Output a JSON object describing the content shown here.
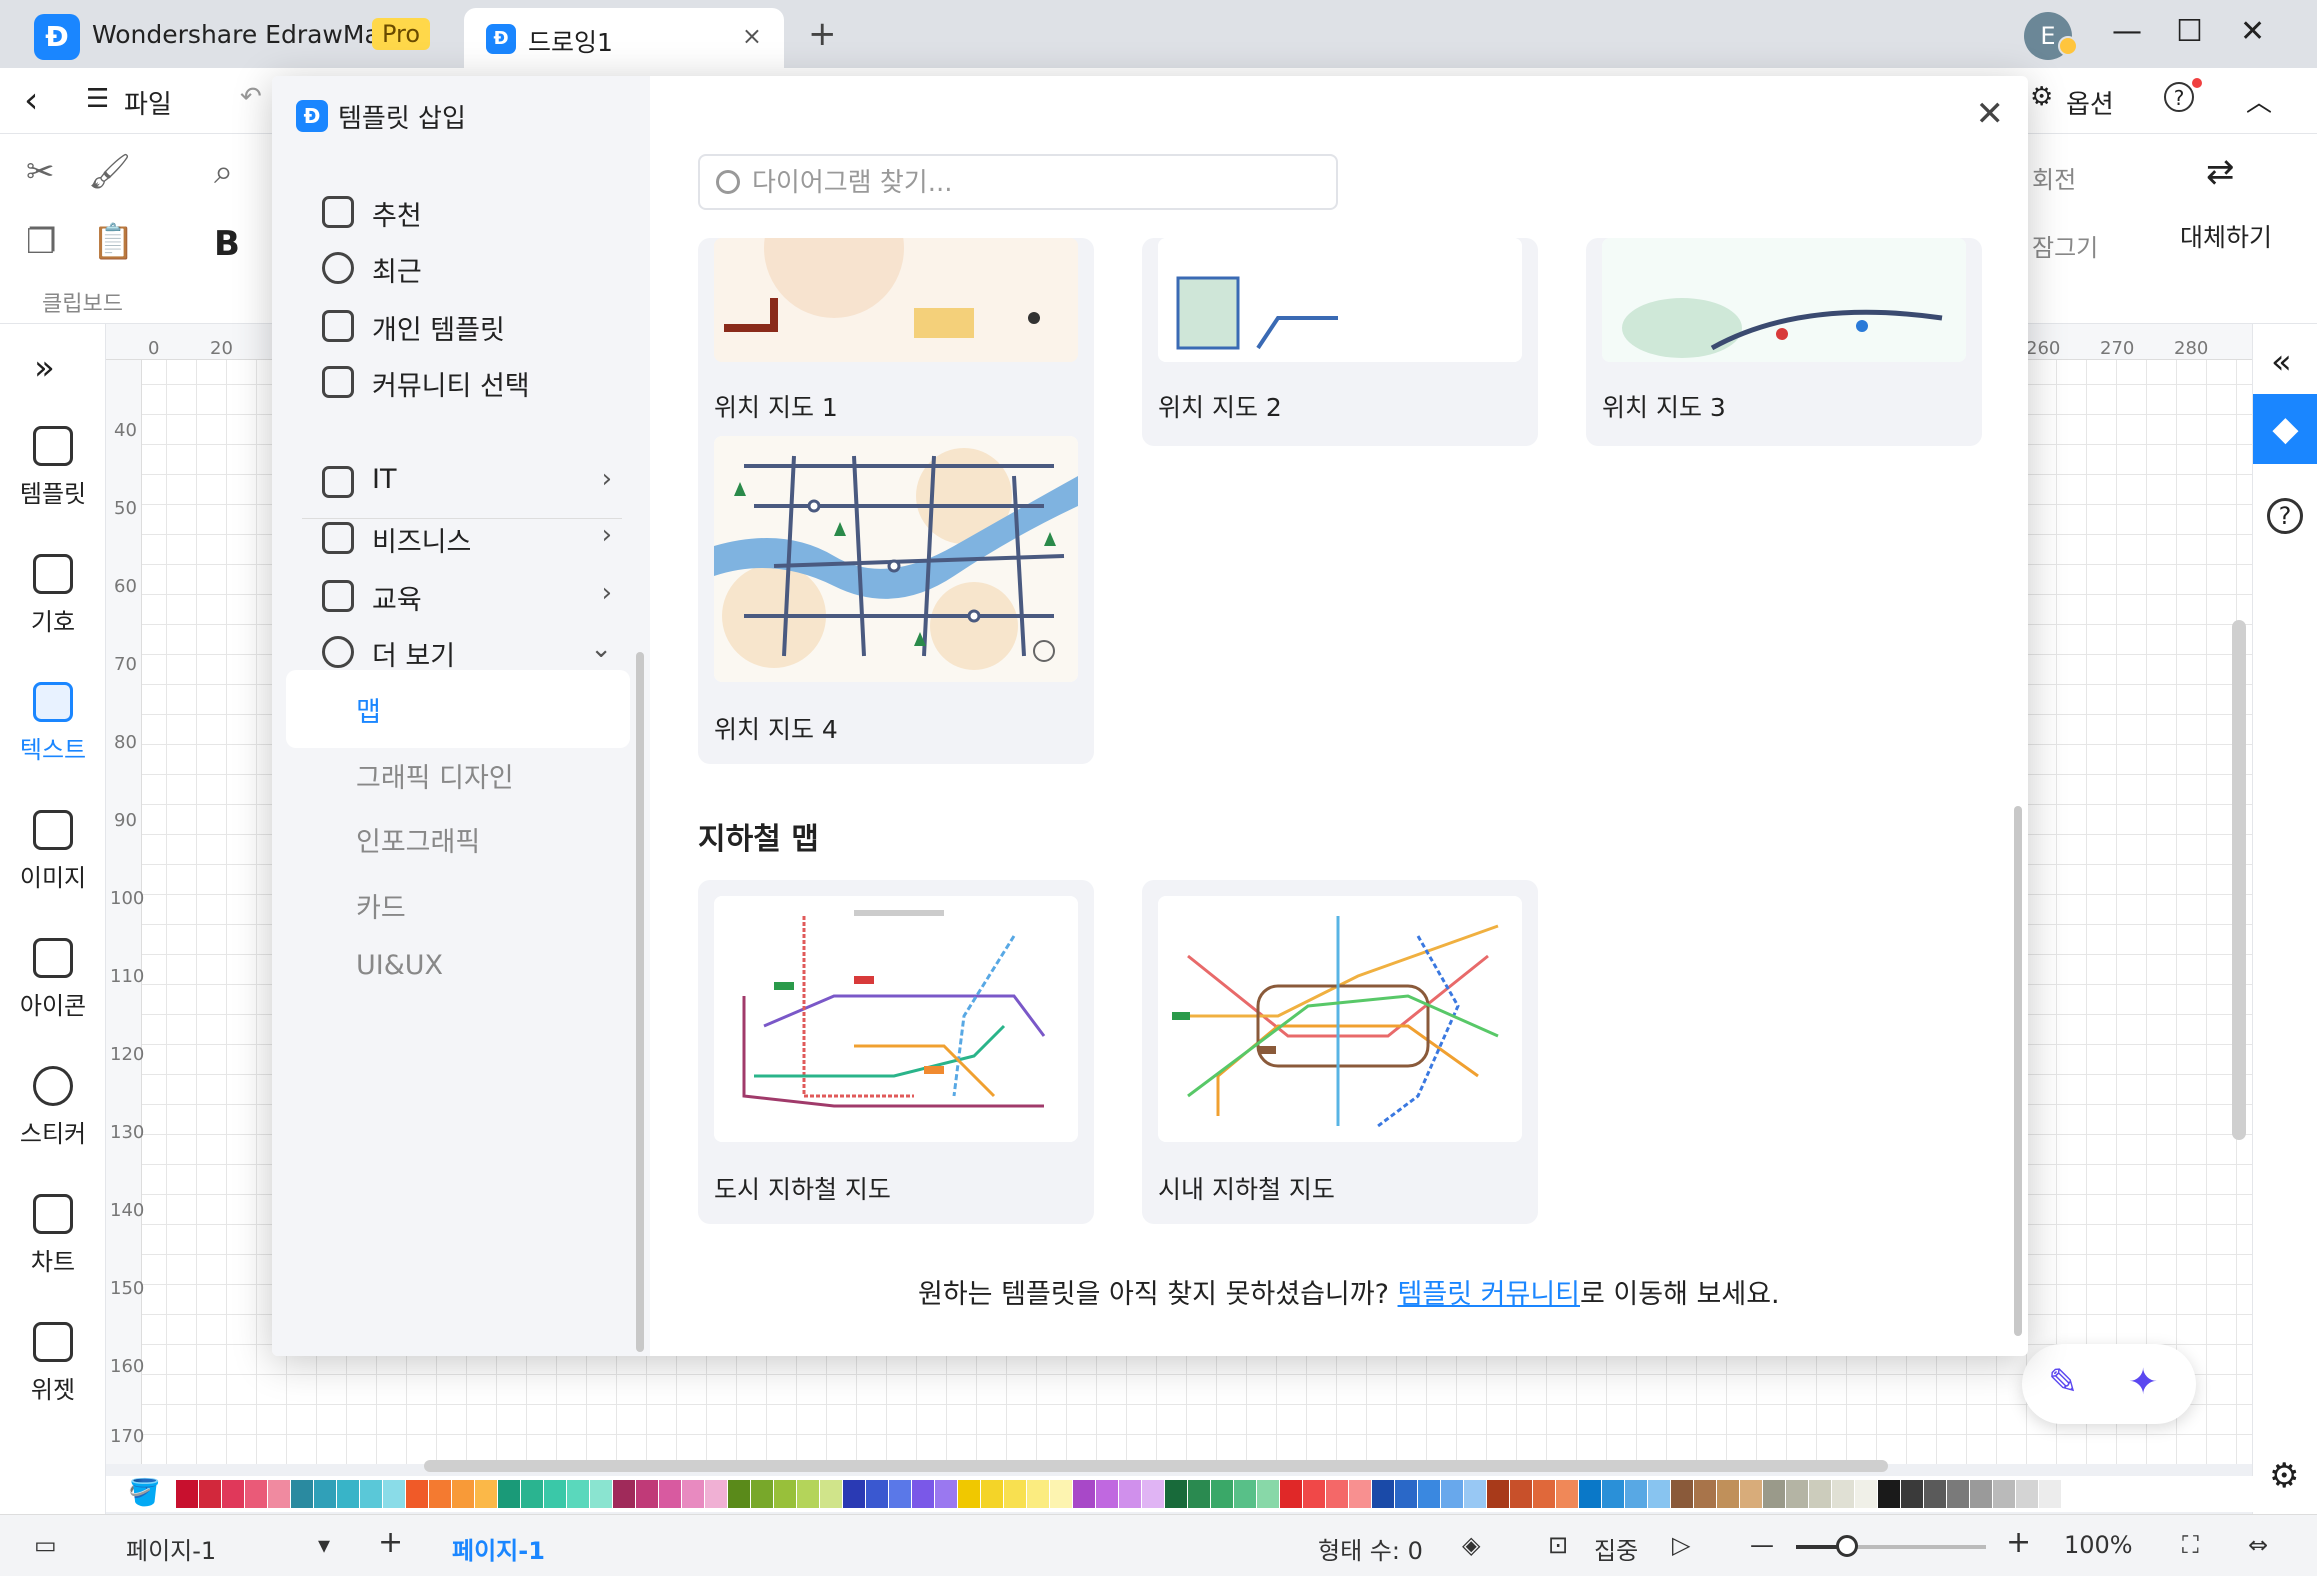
{
  "titlebar": {
    "app_title": "Wondershare EdrawMax",
    "pro_badge": "Pro",
    "doc_tab": "드로잉1",
    "tab_close": "×",
    "new_tab": "+",
    "user_initial": "E",
    "minimize": "—",
    "maximize": "☐",
    "close": "✕"
  },
  "toolbar": {
    "back": "‹",
    "file_menu": "파일",
    "options": "옵션",
    "help": "?"
  },
  "ribbon": {
    "clipboard_label": "클립보드",
    "bold": "B",
    "rotate_label": "회전",
    "lock_label": "잠그기",
    "replace_label": "대체하기"
  },
  "left_sidebar": {
    "items": [
      {
        "label": "템플릿",
        "icon": "template-icon"
      },
      {
        "label": "기호",
        "icon": "symbol-icon"
      },
      {
        "label": "텍스트",
        "icon": "text-icon",
        "active": true
      },
      {
        "label": "이미지",
        "icon": "image-icon"
      },
      {
        "label": "아이콘",
        "icon": "icon-library-icon"
      },
      {
        "label": "스티커",
        "icon": "sticker-icon"
      },
      {
        "label": "차트",
        "icon": "chart-icon"
      },
      {
        "label": "위젯",
        "icon": "widget-icon"
      }
    ]
  },
  "ruler": {
    "h": [
      "0",
      "20",
      "260",
      "270",
      "280"
    ],
    "v": [
      "40",
      "50",
      "60",
      "70",
      "80",
      "90",
      "100",
      "110",
      "120",
      "130",
      "140",
      "150",
      "160",
      "170"
    ]
  },
  "dialog": {
    "title": "템플릿 삽입",
    "close": "✕",
    "nav": [
      {
        "label": "추천",
        "icon": "star-icon"
      },
      {
        "label": "최근",
        "icon": "clock-icon"
      },
      {
        "label": "개인 템플릿",
        "icon": "document-icon"
      },
      {
        "label": "커뮤니티 선택",
        "icon": "community-icon"
      },
      {
        "label": "IT",
        "icon": "monitor-icon",
        "arrow": "›"
      },
      {
        "label": "비즈니스",
        "icon": "briefcase-icon",
        "arrow": "›"
      },
      {
        "label": "교육",
        "icon": "graduation-cap-icon",
        "arrow": "›"
      },
      {
        "label": "더 보기",
        "icon": "more-icon",
        "arrow": "⌄"
      }
    ],
    "subnav": [
      {
        "label": "맵",
        "active": true
      },
      {
        "label": "그래픽 디자인"
      },
      {
        "label": "인포그래픽"
      },
      {
        "label": "카드"
      },
      {
        "label": "UI&UX"
      }
    ],
    "search_placeholder": "다이어그램 찾기...",
    "location_cards": [
      "위치 지도 1",
      "위치 지도 2",
      "위치 지도 3",
      "위치 지도 4"
    ],
    "subway_section_title": "지하철 맵",
    "subway_cards": [
      "도시 지하철 지도",
      "시내 지하철 지도"
    ],
    "footer_prefix": "원하는 템플릿을 아직 찾지 못하셨습니까? ",
    "footer_link": "템플릿 커뮤니티",
    "footer_suffix": "로 이동해 보세요."
  },
  "statusbar": {
    "page_select": "페이지-1",
    "add_page": "+",
    "active_page": "페이지-1",
    "shape_count": "형태 수: 0",
    "focus": "집중",
    "zoom": "100%"
  },
  "palette_colors": [
    "#c8102e",
    "#d2283c",
    "#e0385a",
    "#ea5a78",
    "#f08aa0",
    "#2a8aa0",
    "#30a0b8",
    "#38b4c8",
    "#5ac8d8",
    "#8adce8",
    "#f05a28",
    "#f47a30",
    "#f89a38",
    "#fbb848",
    "#1a9a78",
    "#2ab490",
    "#3ac8a8",
    "#5ad8bc",
    "#8ae4d0",
    "#a02a5a",
    "#c03a78",
    "#d85aa0",
    "#e88ac0",
    "#f0b0d4",
    "#5a8a1a",
    "#78a82a",
    "#98c03a",
    "#b4d45a",
    "#d0e48a",
    "#2a3ab4",
    "#3a58d0",
    "#5a78e8",
    "#7a58e8",
    "#9a78f0",
    "#f0c800",
    "#f4d428",
    "#f8e050",
    "#fbec80",
    "#fdf4b0",
    "#a848c8",
    "#c068e0",
    "#d090ec",
    "#e0b4f4",
    "#186a3a",
    "#2a8a50",
    "#3aa868",
    "#58c088",
    "#88d8a8",
    "#e02828",
    "#f04848",
    "#f46868",
    "#f89090",
    "#1a4aa8",
    "#2a68c8",
    "#3a88e0",
    "#68a8ec",
    "#98c8f4",
    "#a83a1a",
    "#c8502a",
    "#e0683a",
    "#f08858",
    "#0a78c8",
    "#2a90d8",
    "#58a8e4",
    "#88c4f0",
    "#8a5a3a",
    "#a8744a",
    "#c0905a",
    "#d8ac7a",
    "#9a9a8a",
    "#b4b4a4",
    "#ccccbc",
    "#e0e0d4",
    "#f0f0e8",
    "#1a1a1a",
    "#3a3a3a",
    "#5a5a5a",
    "#7a7a7a",
    "#9a9a9a",
    "#bababa",
    "#d4d4d4",
    "#ececec"
  ]
}
